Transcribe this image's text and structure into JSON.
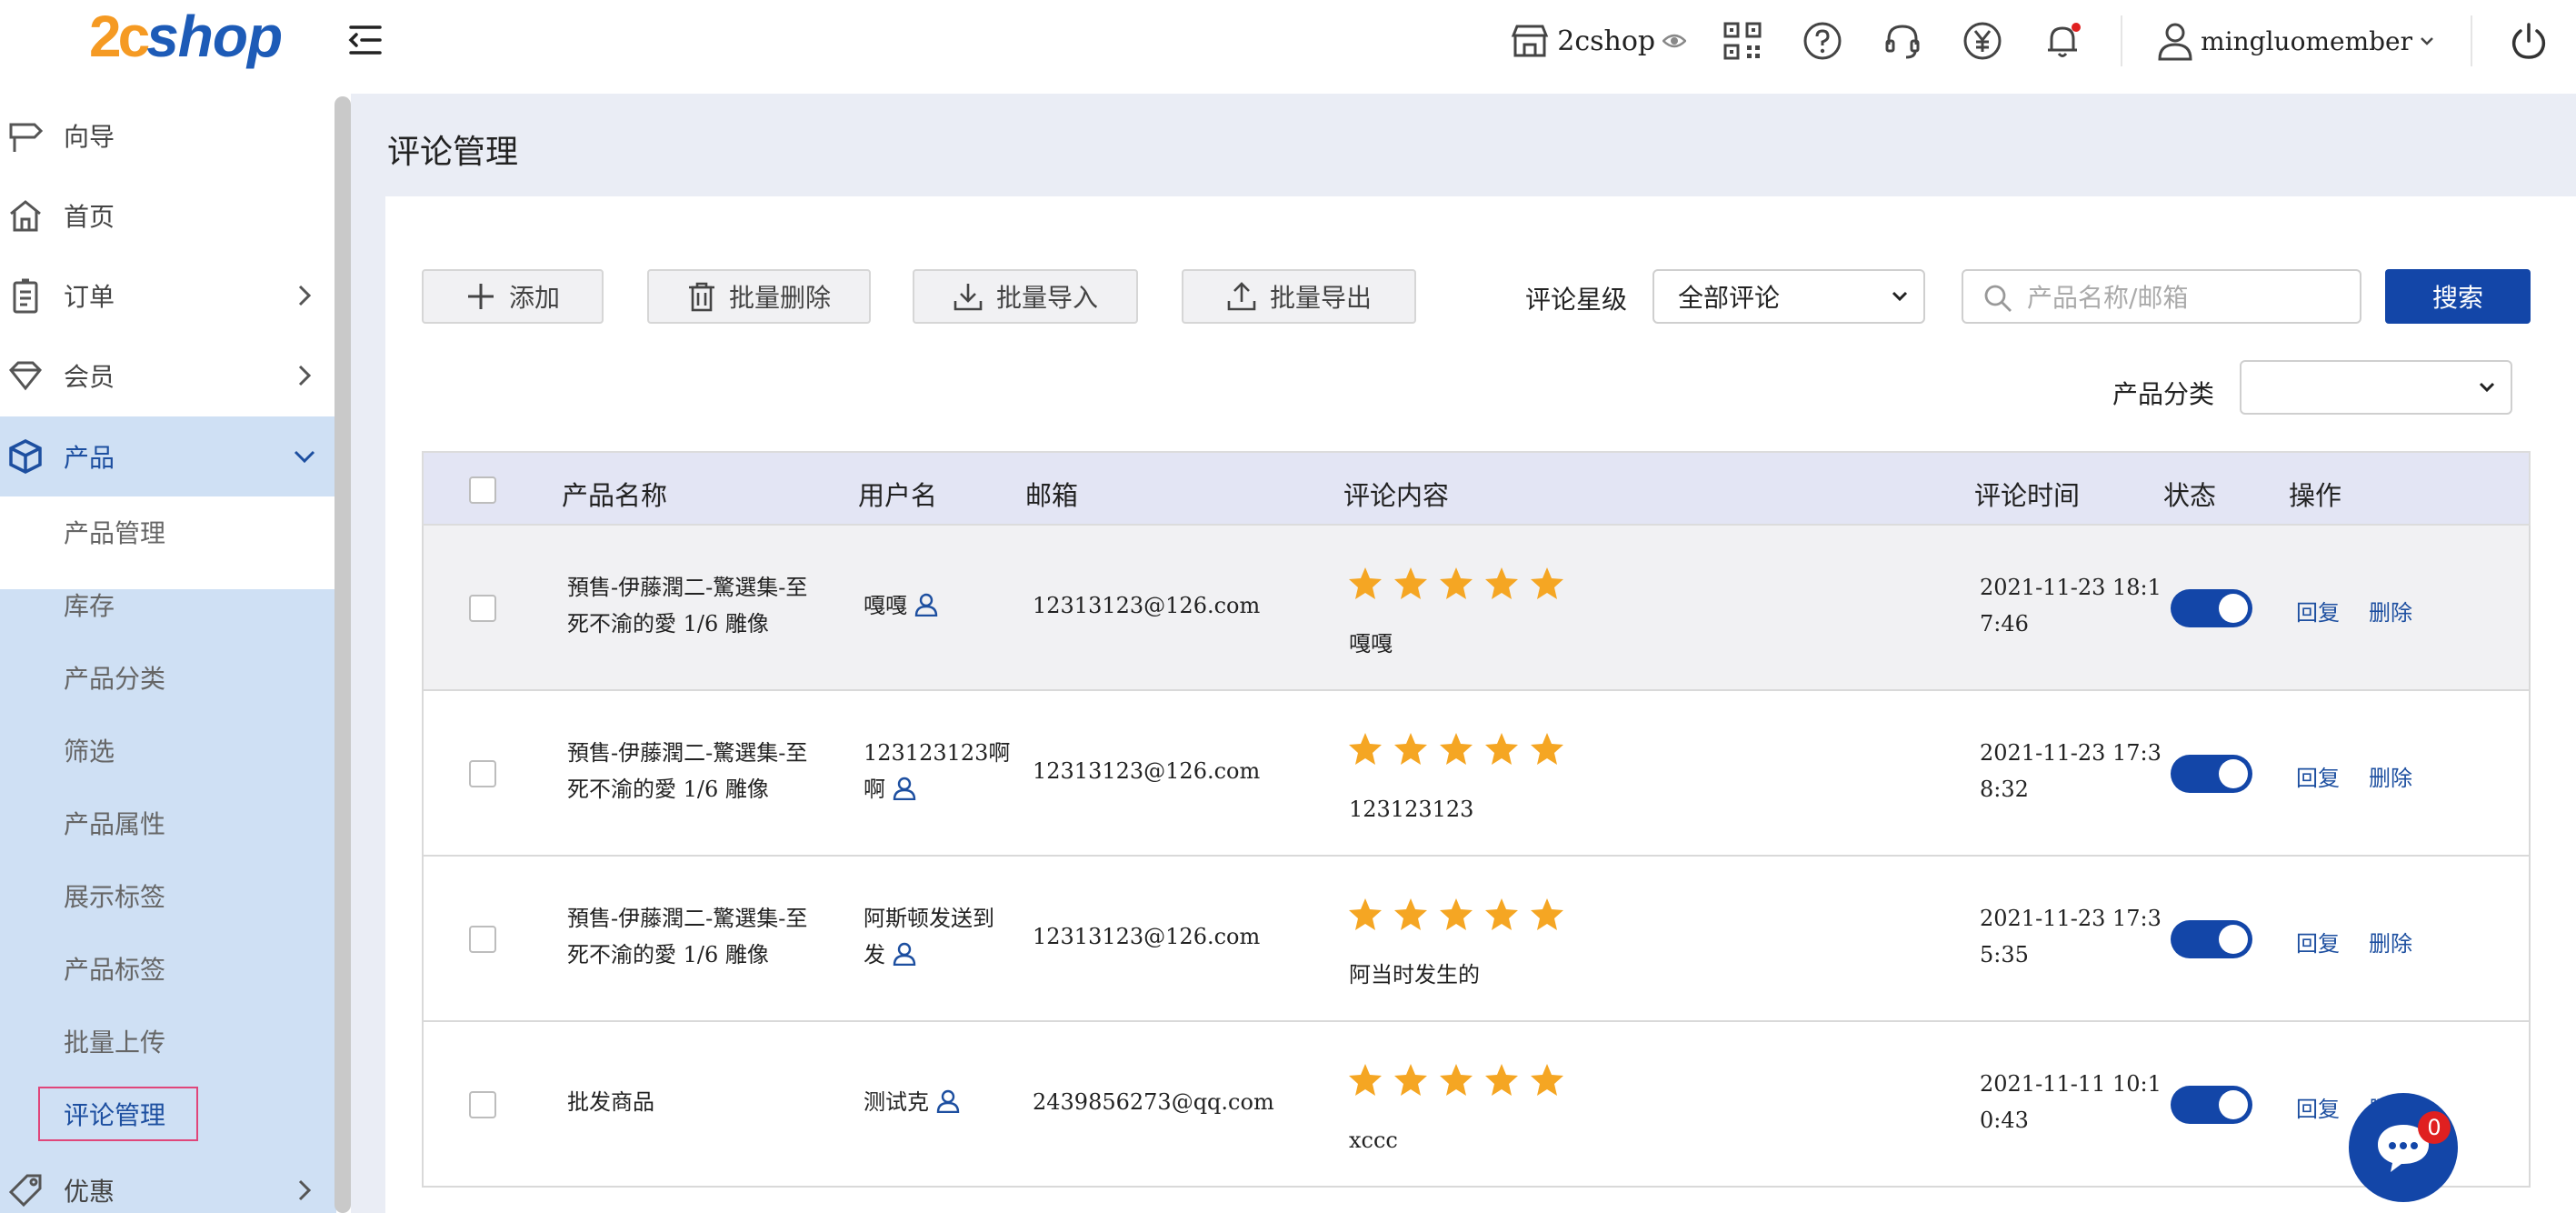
{
  "header": {
    "logo_prefix": "2c",
    "logo_suffix": "shop",
    "store_name": "2cshop",
    "username": "mingluomember"
  },
  "sidebar": {
    "items": [
      {
        "label": "向导",
        "icon": "signpost-icon"
      },
      {
        "label": "首页",
        "icon": "home-icon"
      },
      {
        "label": "订单",
        "icon": "clipboard-icon"
      },
      {
        "label": "会员",
        "icon": "diamond-icon"
      },
      {
        "label": "产品",
        "icon": "box-icon"
      },
      {
        "label": "优惠",
        "icon": "tag-icon"
      }
    ],
    "product_subitems": [
      "产品管理",
      "库存",
      "产品分类",
      "筛选",
      "产品属性",
      "展示标签",
      "产品标签",
      "批量上传",
      "评论管理"
    ]
  },
  "page": {
    "title": "评论管理"
  },
  "toolbar": {
    "add": "添加",
    "batch_delete": "批量删除",
    "batch_import": "批量导入",
    "batch_export": "批量导出",
    "rating_label": "评论星级",
    "rating_value": "全部评论",
    "search_placeholder": "产品名称/邮箱",
    "search_button": "搜索",
    "category_label": "产品分类",
    "category_value": ""
  },
  "table": {
    "headers": [
      "产品名称",
      "用户名",
      "邮箱",
      "评论内容",
      "评论时间",
      "状态",
      "操作"
    ],
    "rows": [
      {
        "product_line1": "預售-伊藤潤二-驚選集-至",
        "product_line2": "死不渝的愛 1/6 雕像",
        "user_line1": "嘎嘎",
        "user_line2": "",
        "email": "12313123@126.com",
        "stars": 5,
        "comment": "嘎嘎",
        "time_line1": "2021-11-23 18:1",
        "time_line2": "7:46",
        "enabled": true,
        "reply": "回复",
        "delete": "删除"
      },
      {
        "product_line1": "預售-伊藤潤二-驚選集-至",
        "product_line2": "死不渝的愛 1/6 雕像",
        "user_line1": "123123123啊",
        "user_line2": "啊",
        "email": "12313123@126.com",
        "stars": 5,
        "comment": "123123123",
        "time_line1": "2021-11-23 17:3",
        "time_line2": "8:32",
        "enabled": true,
        "reply": "回复",
        "delete": "删除"
      },
      {
        "product_line1": "預售-伊藤潤二-驚選集-至",
        "product_line2": "死不渝的愛 1/6 雕像",
        "user_line1": "阿斯顿发送到",
        "user_line2": "发",
        "email": "12313123@126.com",
        "stars": 5,
        "comment": "阿当时发生的",
        "time_line1": "2021-11-23 17:3",
        "time_line2": "5:35",
        "enabled": true,
        "reply": "回复",
        "delete": "删除"
      },
      {
        "product_line1": "批发商品",
        "product_line2": "",
        "user_line1": "测试克",
        "user_line2": "",
        "email": "2439856273@qq.com",
        "stars": 5,
        "comment": "xccc",
        "time_line1": "2021-11-11 10:1",
        "time_line2": "0:43",
        "enabled": true,
        "reply": "回复",
        "delete": "删除"
      }
    ]
  },
  "chat": {
    "badge": "0"
  },
  "colors": {
    "primary": "#1346a8",
    "star": "#f5a623",
    "sidebar_active": "#cfe0f4",
    "logo_orange": "#f59a23",
    "logo_blue": "#1d5bb7"
  }
}
